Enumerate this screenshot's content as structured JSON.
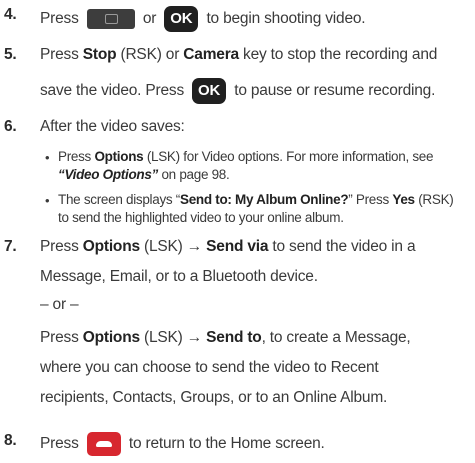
{
  "steps": [
    {
      "num": "4.",
      "lines": [
        {
          "a": "Press",
          "b": "or",
          "c": "to begin shooting video."
        }
      ]
    },
    {
      "num": "5.",
      "lines": [
        {
          "a": "Press ",
          "b": "Stop",
          "c": " (RSK) or ",
          "d": "Camera",
          "e": " key to stop the recording and"
        },
        {
          "a": "save the video. Press",
          "b": "to pause or resume recording."
        }
      ]
    },
    {
      "num": "6.",
      "lines": [
        {
          "a": "After the video saves:"
        }
      ],
      "bullets": [
        {
          "l1a": "Press ",
          "l1b": "Options",
          "l1c": " (LSK) for Video options. For more information, see",
          "l2a": "“Video Options”",
          "l2b": " on page 98."
        },
        {
          "l1a": "The screen displays “",
          "l1b": "Send to: My Album Online?",
          "l1c": "” Press ",
          "l1d": "Yes",
          "l1e": " (RSK)",
          "l2a": "to send the highlighted video to your online album."
        }
      ]
    },
    {
      "num": "7.",
      "lines": [
        {
          "a": "Press ",
          "b": "Options",
          "c": " (LSK) → ",
          "d": "Send via",
          "e": " to send the video in a"
        },
        {
          "a": "Message, Email, or to a Bluetooth device."
        },
        {
          "a": "– or –"
        },
        {
          "a": "Press ",
          "b": "Options",
          "c": " (LSK) → ",
          "d": "Send to",
          "e": ", to create a Message,"
        },
        {
          "a": "where you can choose to send the video to Recent"
        },
        {
          "a": "recipients, Contacts, Groups, or to an Online Album."
        }
      ]
    },
    {
      "num": "8.",
      "lines": [
        {
          "a": "Press",
          "b": "to return to the Home screen."
        }
      ]
    }
  ],
  "keys": {
    "ok": "OK",
    "camera_icon": "camera-key-icon",
    "end_icon": "end-call-key-icon"
  },
  "colors": {
    "end_key": "#d7272f",
    "ok_key": "#202020"
  }
}
